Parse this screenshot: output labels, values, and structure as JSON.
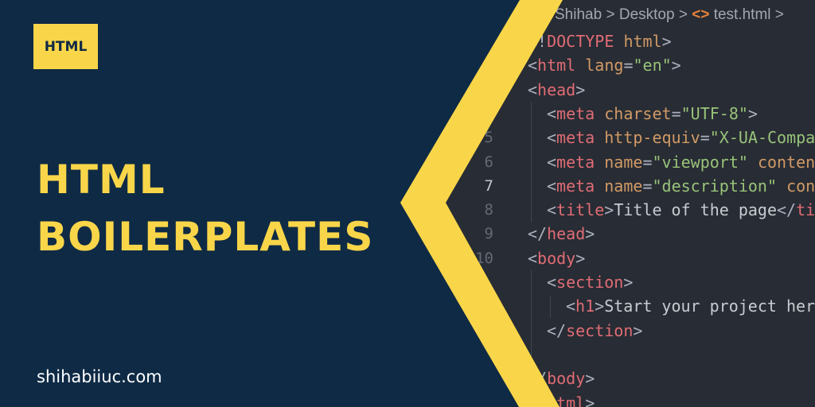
{
  "badge": "HTML",
  "title": {
    "line1": "HTML",
    "line2": "BOILERPLATES"
  },
  "website": "shihabiiuc.com",
  "colors": {
    "navy": "#0f2a45",
    "yellow": "#f9d649",
    "editor_bg": "#282c34"
  },
  "editor": {
    "breadcrumb": {
      "folder1": "Shihab",
      "folder2": "Desktop",
      "file_icon": "code-brackets-icon",
      "file": "test.html",
      "sep": ">"
    },
    "line_numbers": [
      {
        "n": "5",
        "row": 5
      },
      {
        "n": "6",
        "row": 6
      },
      {
        "n": "7",
        "row": 7,
        "current": true
      },
      {
        "n": "8",
        "row": 8
      },
      {
        "n": "9",
        "row": 9
      },
      {
        "n": "10",
        "row": 10
      }
    ],
    "lines": [
      {
        "indent": 0,
        "tokens": [
          [
            "p",
            "<!"
          ],
          [
            "tag",
            "DOCTYPE"
          ],
          [
            "p",
            " "
          ],
          [
            "attr",
            "html"
          ],
          [
            "p",
            ">"
          ]
        ]
      },
      {
        "indent": 0,
        "tokens": [
          [
            "p",
            "<"
          ],
          [
            "tag",
            "html"
          ],
          [
            "p",
            " "
          ],
          [
            "attr",
            "lang"
          ],
          [
            "p",
            "="
          ],
          [
            "str",
            "\"en\""
          ],
          [
            "p",
            ">"
          ]
        ]
      },
      {
        "indent": 0,
        "tokens": [
          [
            "p",
            "<"
          ],
          [
            "tag",
            "head"
          ],
          [
            "p",
            ">"
          ]
        ]
      },
      {
        "indent": 1,
        "tokens": [
          [
            "p",
            "<"
          ],
          [
            "tag",
            "meta"
          ],
          [
            "p",
            " "
          ],
          [
            "attr",
            "charset"
          ],
          [
            "p",
            "="
          ],
          [
            "str",
            "\"UTF-8\""
          ],
          [
            "p",
            ">"
          ]
        ]
      },
      {
        "indent": 1,
        "tokens": [
          [
            "p",
            "<"
          ],
          [
            "tag",
            "meta"
          ],
          [
            "p",
            " "
          ],
          [
            "attr",
            "http-equiv"
          ],
          [
            "p",
            "="
          ],
          [
            "str",
            "\"X-UA-Compa"
          ]
        ]
      },
      {
        "indent": 1,
        "tokens": [
          [
            "p",
            "<"
          ],
          [
            "tag",
            "meta"
          ],
          [
            "p",
            " "
          ],
          [
            "attr",
            "name"
          ],
          [
            "p",
            "="
          ],
          [
            "str",
            "\"viewport\""
          ],
          [
            "p",
            " "
          ],
          [
            "attr",
            "conten"
          ]
        ]
      },
      {
        "indent": 1,
        "tokens": [
          [
            "p",
            "<"
          ],
          [
            "tag",
            "meta"
          ],
          [
            "p",
            " "
          ],
          [
            "attr",
            "name"
          ],
          [
            "p",
            "="
          ],
          [
            "str",
            "\"description\""
          ],
          [
            "p",
            " "
          ],
          [
            "attr",
            "con"
          ]
        ]
      },
      {
        "indent": 1,
        "tokens": [
          [
            "p",
            "<"
          ],
          [
            "tag",
            "title"
          ],
          [
            "p",
            ">"
          ],
          [
            "txt",
            "Title of the page"
          ],
          [
            "p",
            "</"
          ],
          [
            "tag",
            "ti"
          ]
        ]
      },
      {
        "indent": 0,
        "tokens": [
          [
            "p",
            "</"
          ],
          [
            "tag",
            "head"
          ],
          [
            "p",
            ">"
          ]
        ]
      },
      {
        "indent": 0,
        "tokens": [
          [
            "p",
            "<"
          ],
          [
            "tag",
            "body"
          ],
          [
            "p",
            ">"
          ]
        ]
      },
      {
        "indent": 1,
        "tokens": [
          [
            "p",
            "<"
          ],
          [
            "tag",
            "section"
          ],
          [
            "p",
            ">"
          ]
        ]
      },
      {
        "indent": 2,
        "tokens": [
          [
            "p",
            "<"
          ],
          [
            "tag",
            "h1"
          ],
          [
            "p",
            ">"
          ],
          [
            "txt",
            "Start your project her"
          ]
        ]
      },
      {
        "indent": 1,
        "tokens": [
          [
            "p",
            "</"
          ],
          [
            "tag",
            "section"
          ],
          [
            "p",
            ">"
          ]
        ]
      },
      {
        "indent": 0,
        "tokens": []
      },
      {
        "indent": 0,
        "tokens": [
          [
            "p",
            "</"
          ],
          [
            "tag",
            "body"
          ],
          [
            "p",
            ">"
          ]
        ]
      },
      {
        "indent": 0,
        "tokens": [
          [
            "p",
            "</"
          ],
          [
            "tag",
            "html"
          ],
          [
            "p",
            ">"
          ]
        ]
      }
    ]
  }
}
